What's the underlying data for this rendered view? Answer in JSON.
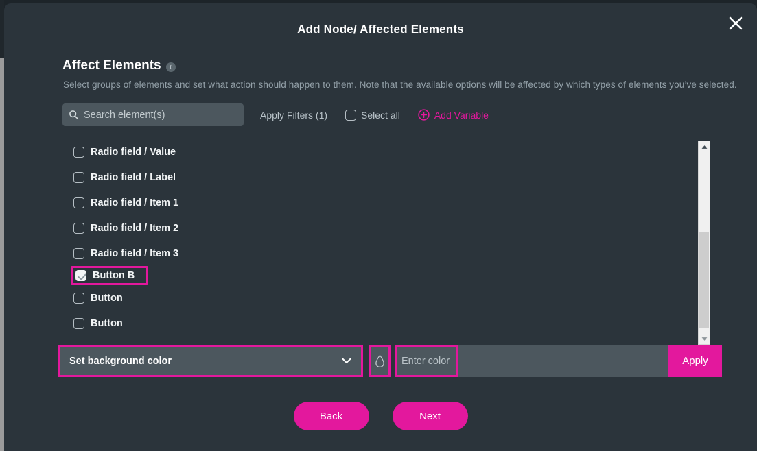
{
  "modal": {
    "title": "Add Node/ Affected Elements",
    "close_icon": "close-icon"
  },
  "section": {
    "title": "Affect Elements",
    "info_icon": "i",
    "subtitle": "Select groups of elements and set what action should happen to them. Note that the available options will be affected by which types of elements you’ve selected."
  },
  "toolbar": {
    "search_placeholder": "Search element(s)",
    "search_value": "",
    "search_icon": "search-icon",
    "apply_filters_label": "Apply Filters (1)",
    "select_all_label": "Select all",
    "select_all_checked": false,
    "add_variable_label": "Add Variable",
    "add_variable_icon": "plus-circle-icon"
  },
  "elements": [
    {
      "label": "Radio field / Value",
      "checked": false,
      "highlighted": false
    },
    {
      "label": "Radio field / Label",
      "checked": false,
      "highlighted": false
    },
    {
      "label": "Radio field / Item 1",
      "checked": false,
      "highlighted": false
    },
    {
      "label": "Radio field / Item 2",
      "checked": false,
      "highlighted": false
    },
    {
      "label": "Radio field / Item 3",
      "checked": false,
      "highlighted": false
    },
    {
      "label": "Button B",
      "checked": true,
      "highlighted": true
    },
    {
      "label": "Button",
      "checked": false,
      "highlighted": false
    },
    {
      "label": "Button",
      "checked": false,
      "highlighted": false
    }
  ],
  "scrollbar": {
    "up_arrow_icon": "chevron-up-icon",
    "down_arrow_icon": "chevron-down-icon"
  },
  "action_bar": {
    "select_value": "Set background color",
    "select_chevron_icon": "chevron-down-icon",
    "droplet_icon": "droplet-icon",
    "color_placeholder": "Enter color",
    "color_value": "",
    "apply_label": "Apply"
  },
  "footer": {
    "back_label": "Back",
    "next_label": "Next"
  },
  "colors": {
    "accent": "#e3189d",
    "modal_bg": "#2b343b",
    "field_bg": "#4c575e",
    "page_bg": "#1d2429"
  }
}
